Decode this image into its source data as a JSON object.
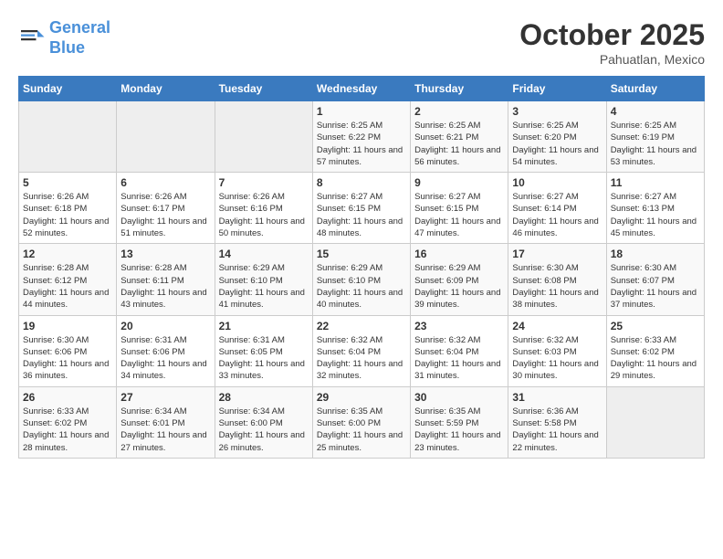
{
  "header": {
    "logo_line1": "General",
    "logo_line2": "Blue",
    "month": "October 2025",
    "location": "Pahuatlan, Mexico"
  },
  "days_of_week": [
    "Sunday",
    "Monday",
    "Tuesday",
    "Wednesday",
    "Thursday",
    "Friday",
    "Saturday"
  ],
  "weeks": [
    [
      {
        "day": "",
        "info": ""
      },
      {
        "day": "",
        "info": ""
      },
      {
        "day": "",
        "info": ""
      },
      {
        "day": "1",
        "info": "Sunrise: 6:25 AM\nSunset: 6:22 PM\nDaylight: 11 hours and 57 minutes."
      },
      {
        "day": "2",
        "info": "Sunrise: 6:25 AM\nSunset: 6:21 PM\nDaylight: 11 hours and 56 minutes."
      },
      {
        "day": "3",
        "info": "Sunrise: 6:25 AM\nSunset: 6:20 PM\nDaylight: 11 hours and 54 minutes."
      },
      {
        "day": "4",
        "info": "Sunrise: 6:25 AM\nSunset: 6:19 PM\nDaylight: 11 hours and 53 minutes."
      }
    ],
    [
      {
        "day": "5",
        "info": "Sunrise: 6:26 AM\nSunset: 6:18 PM\nDaylight: 11 hours and 52 minutes."
      },
      {
        "day": "6",
        "info": "Sunrise: 6:26 AM\nSunset: 6:17 PM\nDaylight: 11 hours and 51 minutes."
      },
      {
        "day": "7",
        "info": "Sunrise: 6:26 AM\nSunset: 6:16 PM\nDaylight: 11 hours and 50 minutes."
      },
      {
        "day": "8",
        "info": "Sunrise: 6:27 AM\nSunset: 6:15 PM\nDaylight: 11 hours and 48 minutes."
      },
      {
        "day": "9",
        "info": "Sunrise: 6:27 AM\nSunset: 6:15 PM\nDaylight: 11 hours and 47 minutes."
      },
      {
        "day": "10",
        "info": "Sunrise: 6:27 AM\nSunset: 6:14 PM\nDaylight: 11 hours and 46 minutes."
      },
      {
        "day": "11",
        "info": "Sunrise: 6:27 AM\nSunset: 6:13 PM\nDaylight: 11 hours and 45 minutes."
      }
    ],
    [
      {
        "day": "12",
        "info": "Sunrise: 6:28 AM\nSunset: 6:12 PM\nDaylight: 11 hours and 44 minutes."
      },
      {
        "day": "13",
        "info": "Sunrise: 6:28 AM\nSunset: 6:11 PM\nDaylight: 11 hours and 43 minutes."
      },
      {
        "day": "14",
        "info": "Sunrise: 6:29 AM\nSunset: 6:10 PM\nDaylight: 11 hours and 41 minutes."
      },
      {
        "day": "15",
        "info": "Sunrise: 6:29 AM\nSunset: 6:10 PM\nDaylight: 11 hours and 40 minutes."
      },
      {
        "day": "16",
        "info": "Sunrise: 6:29 AM\nSunset: 6:09 PM\nDaylight: 11 hours and 39 minutes."
      },
      {
        "day": "17",
        "info": "Sunrise: 6:30 AM\nSunset: 6:08 PM\nDaylight: 11 hours and 38 minutes."
      },
      {
        "day": "18",
        "info": "Sunrise: 6:30 AM\nSunset: 6:07 PM\nDaylight: 11 hours and 37 minutes."
      }
    ],
    [
      {
        "day": "19",
        "info": "Sunrise: 6:30 AM\nSunset: 6:06 PM\nDaylight: 11 hours and 36 minutes."
      },
      {
        "day": "20",
        "info": "Sunrise: 6:31 AM\nSunset: 6:06 PM\nDaylight: 11 hours and 34 minutes."
      },
      {
        "day": "21",
        "info": "Sunrise: 6:31 AM\nSunset: 6:05 PM\nDaylight: 11 hours and 33 minutes."
      },
      {
        "day": "22",
        "info": "Sunrise: 6:32 AM\nSunset: 6:04 PM\nDaylight: 11 hours and 32 minutes."
      },
      {
        "day": "23",
        "info": "Sunrise: 6:32 AM\nSunset: 6:04 PM\nDaylight: 11 hours and 31 minutes."
      },
      {
        "day": "24",
        "info": "Sunrise: 6:32 AM\nSunset: 6:03 PM\nDaylight: 11 hours and 30 minutes."
      },
      {
        "day": "25",
        "info": "Sunrise: 6:33 AM\nSunset: 6:02 PM\nDaylight: 11 hours and 29 minutes."
      }
    ],
    [
      {
        "day": "26",
        "info": "Sunrise: 6:33 AM\nSunset: 6:02 PM\nDaylight: 11 hours and 28 minutes."
      },
      {
        "day": "27",
        "info": "Sunrise: 6:34 AM\nSunset: 6:01 PM\nDaylight: 11 hours and 27 minutes."
      },
      {
        "day": "28",
        "info": "Sunrise: 6:34 AM\nSunset: 6:00 PM\nDaylight: 11 hours and 26 minutes."
      },
      {
        "day": "29",
        "info": "Sunrise: 6:35 AM\nSunset: 6:00 PM\nDaylight: 11 hours and 25 minutes."
      },
      {
        "day": "30",
        "info": "Sunrise: 6:35 AM\nSunset: 5:59 PM\nDaylight: 11 hours and 23 minutes."
      },
      {
        "day": "31",
        "info": "Sunrise: 6:36 AM\nSunset: 5:58 PM\nDaylight: 11 hours and 22 minutes."
      },
      {
        "day": "",
        "info": ""
      }
    ]
  ]
}
